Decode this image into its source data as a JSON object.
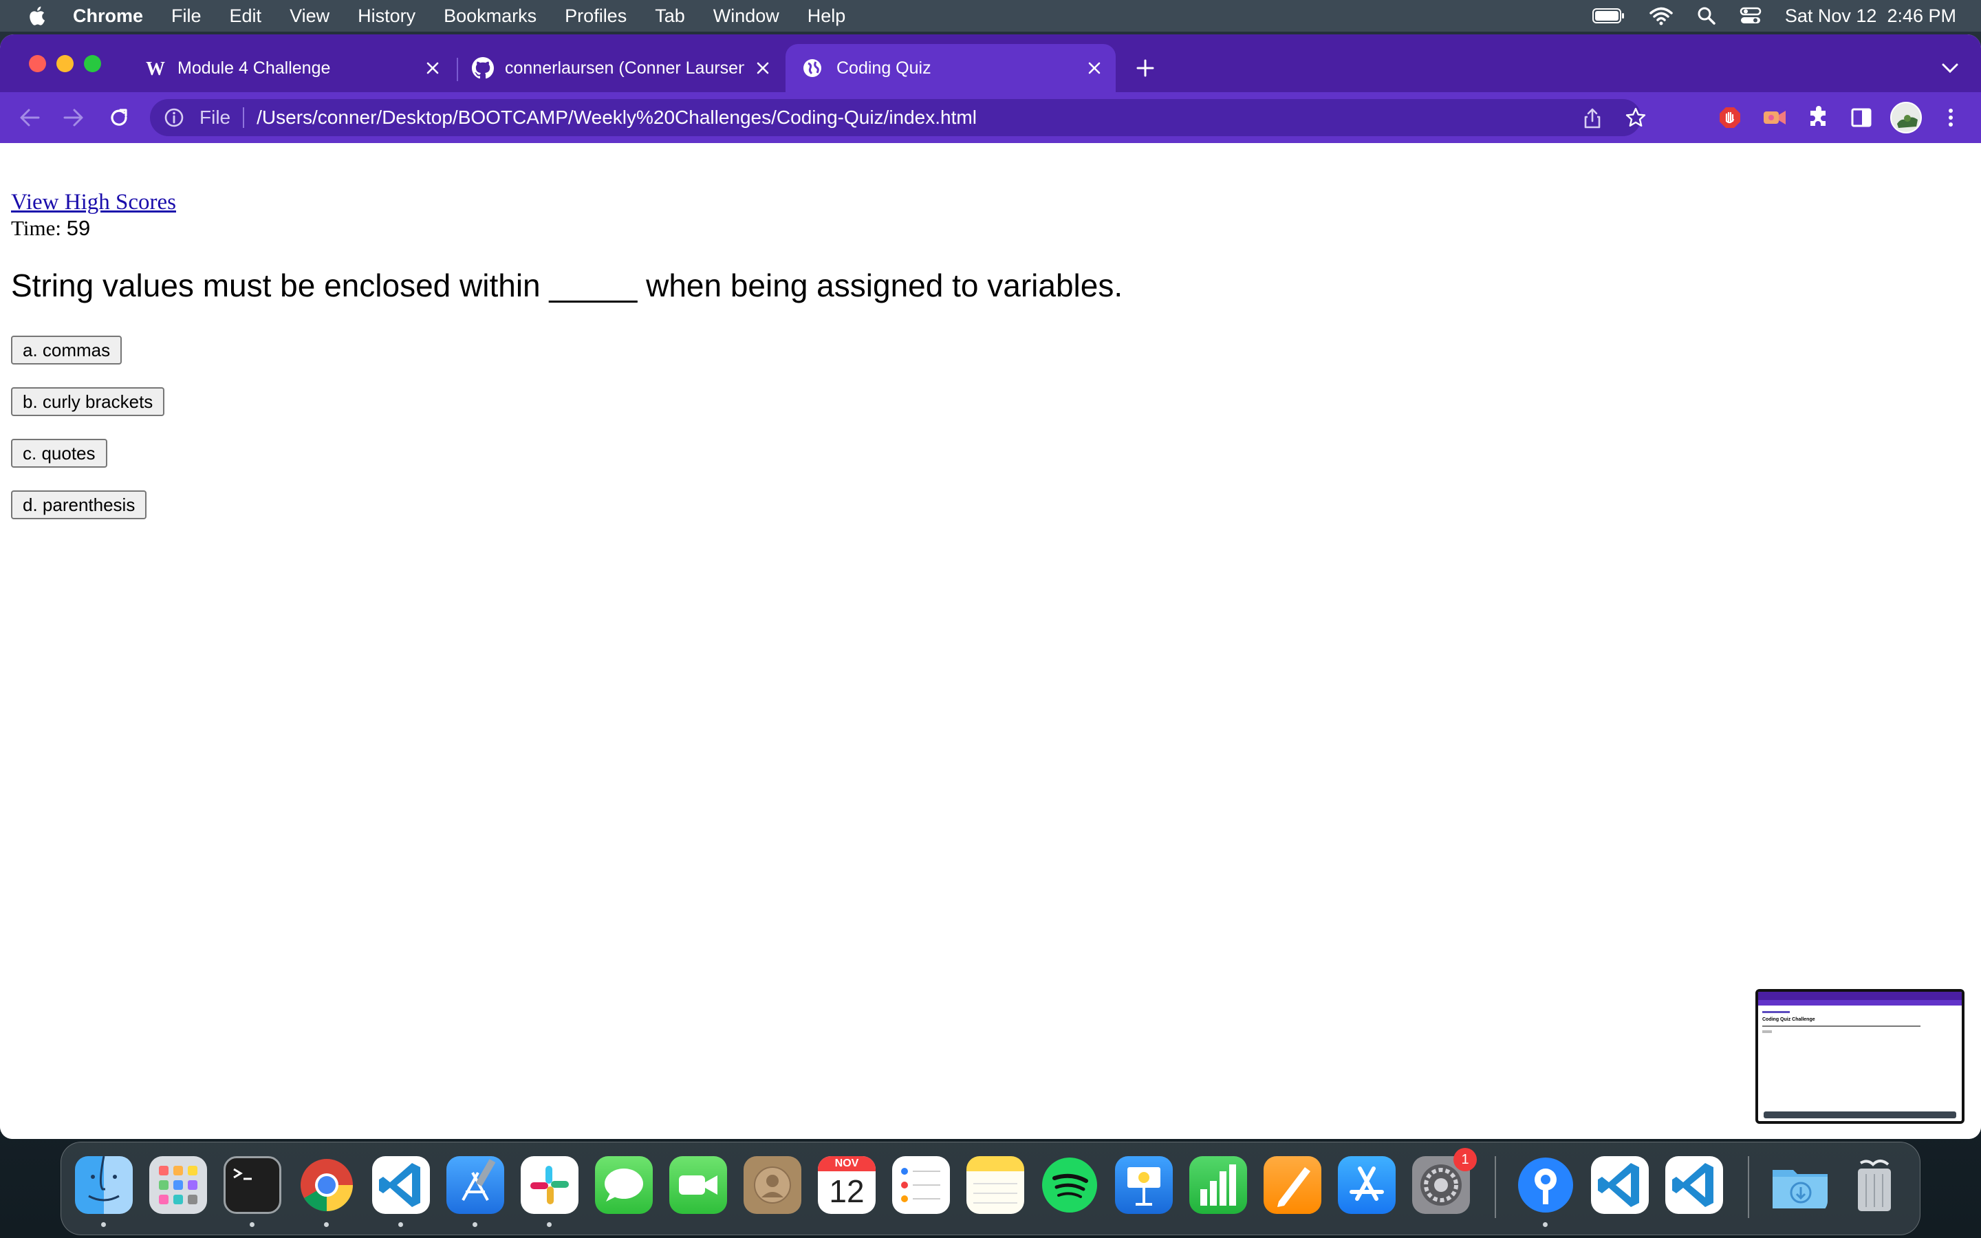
{
  "menubar": {
    "app_name": "Chrome",
    "menus": [
      "File",
      "Edit",
      "View",
      "History",
      "Bookmarks",
      "Profiles",
      "Tab",
      "Window",
      "Help"
    ],
    "date": "Sat Nov 12",
    "time": "2:46 PM"
  },
  "browser": {
    "tabs": [
      {
        "title": "Module 4 Challenge",
        "favicon": "w-icon"
      },
      {
        "title": "connerlaursen (Conner Laursen)",
        "favicon": "github-icon"
      },
      {
        "title": "Coding Quiz",
        "favicon": "globe-icon",
        "active": true
      }
    ],
    "omnibox": {
      "scheme_label": "File",
      "url": "/Users/conner/Desktop/BOOTCAMP/Weekly%20Challenges/Coding-Quiz/index.html"
    },
    "theme_color": "#6133c9",
    "tabstrip_color": "#4a1fa2"
  },
  "page": {
    "high_scores_link": "View High Scores",
    "timer_label": "Time:",
    "timer_value": "59",
    "question": "String values must be enclosed within _____ when being assigned to variables.",
    "answers": [
      "a. commas",
      "b. curly brackets",
      "c. quotes",
      "d. parenthesis"
    ]
  },
  "thumbnail": {
    "title": "Coding Quiz Challenge"
  },
  "dock": {
    "apps": [
      "Finder",
      "Launchpad",
      "Terminal",
      "Google Chrome",
      "Visual Studio Code",
      "Xcode",
      "Slack",
      "Messages",
      "FaceTime",
      "Contacts",
      "Calendar",
      "Reminders",
      "Notes",
      "Spotify",
      "Keynote",
      "Numbers",
      "Pages",
      "App Store",
      "System Preferences",
      "Sourcetree",
      "Visual Studio Code",
      "Visual Studio Code",
      "Downloads",
      "Trash"
    ],
    "calendar_month": "NOV",
    "calendar_day": "12",
    "system_prefs_badge": "1"
  }
}
